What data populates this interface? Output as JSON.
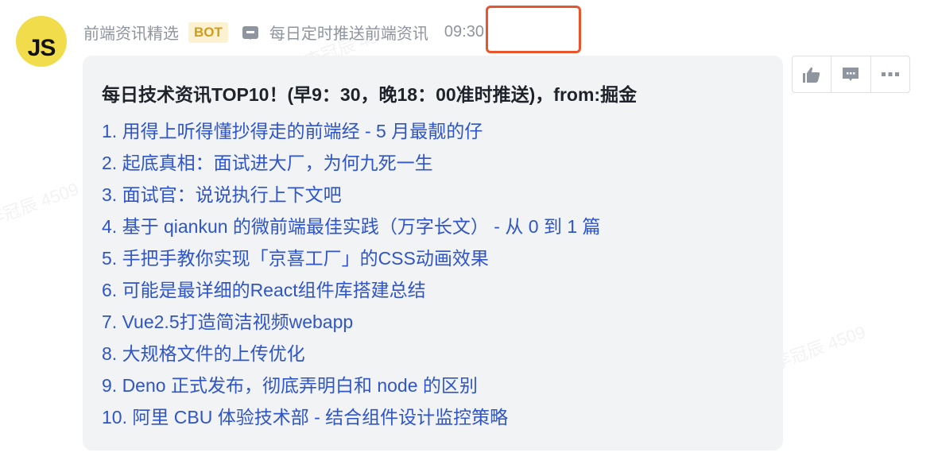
{
  "sender": {
    "avatar_text": "JS",
    "name": "前端资讯精选",
    "badge": "BOT",
    "channel": "每日定时推送前端资讯",
    "time": "09:30"
  },
  "message": {
    "title": "每日技术资讯TOP10！(早9：30，晚18：00准时推送)，from:掘金",
    "items": [
      "1. 用得上听得懂抄得走的前端经 - 5 月最靓的仔",
      "2. 起底真相：面试进大厂，为何九死一生",
      "3. 面试官：说说执行上下文吧",
      "4. 基于 qiankun 的微前端最佳实践（万字长文） - 从 0 到 1 篇",
      "5. 手把手教你实现「京喜工厂」的CSS动画效果",
      "6. 可能是最详细的React组件库搭建总结",
      "7. Vue2.5打造简洁视频webapp",
      "8. 大规格文件的上传优化",
      "9. Deno 正式发布，彻底弄明白和 node 的区别",
      "10. 阿里 CBU 体验技术部 - 结合组件设计监控策略"
    ]
  },
  "actions": {
    "like_icon": "👍",
    "reply_icon": "💬",
    "more_icon": "···"
  },
  "watermark": "李冠辰 4509"
}
